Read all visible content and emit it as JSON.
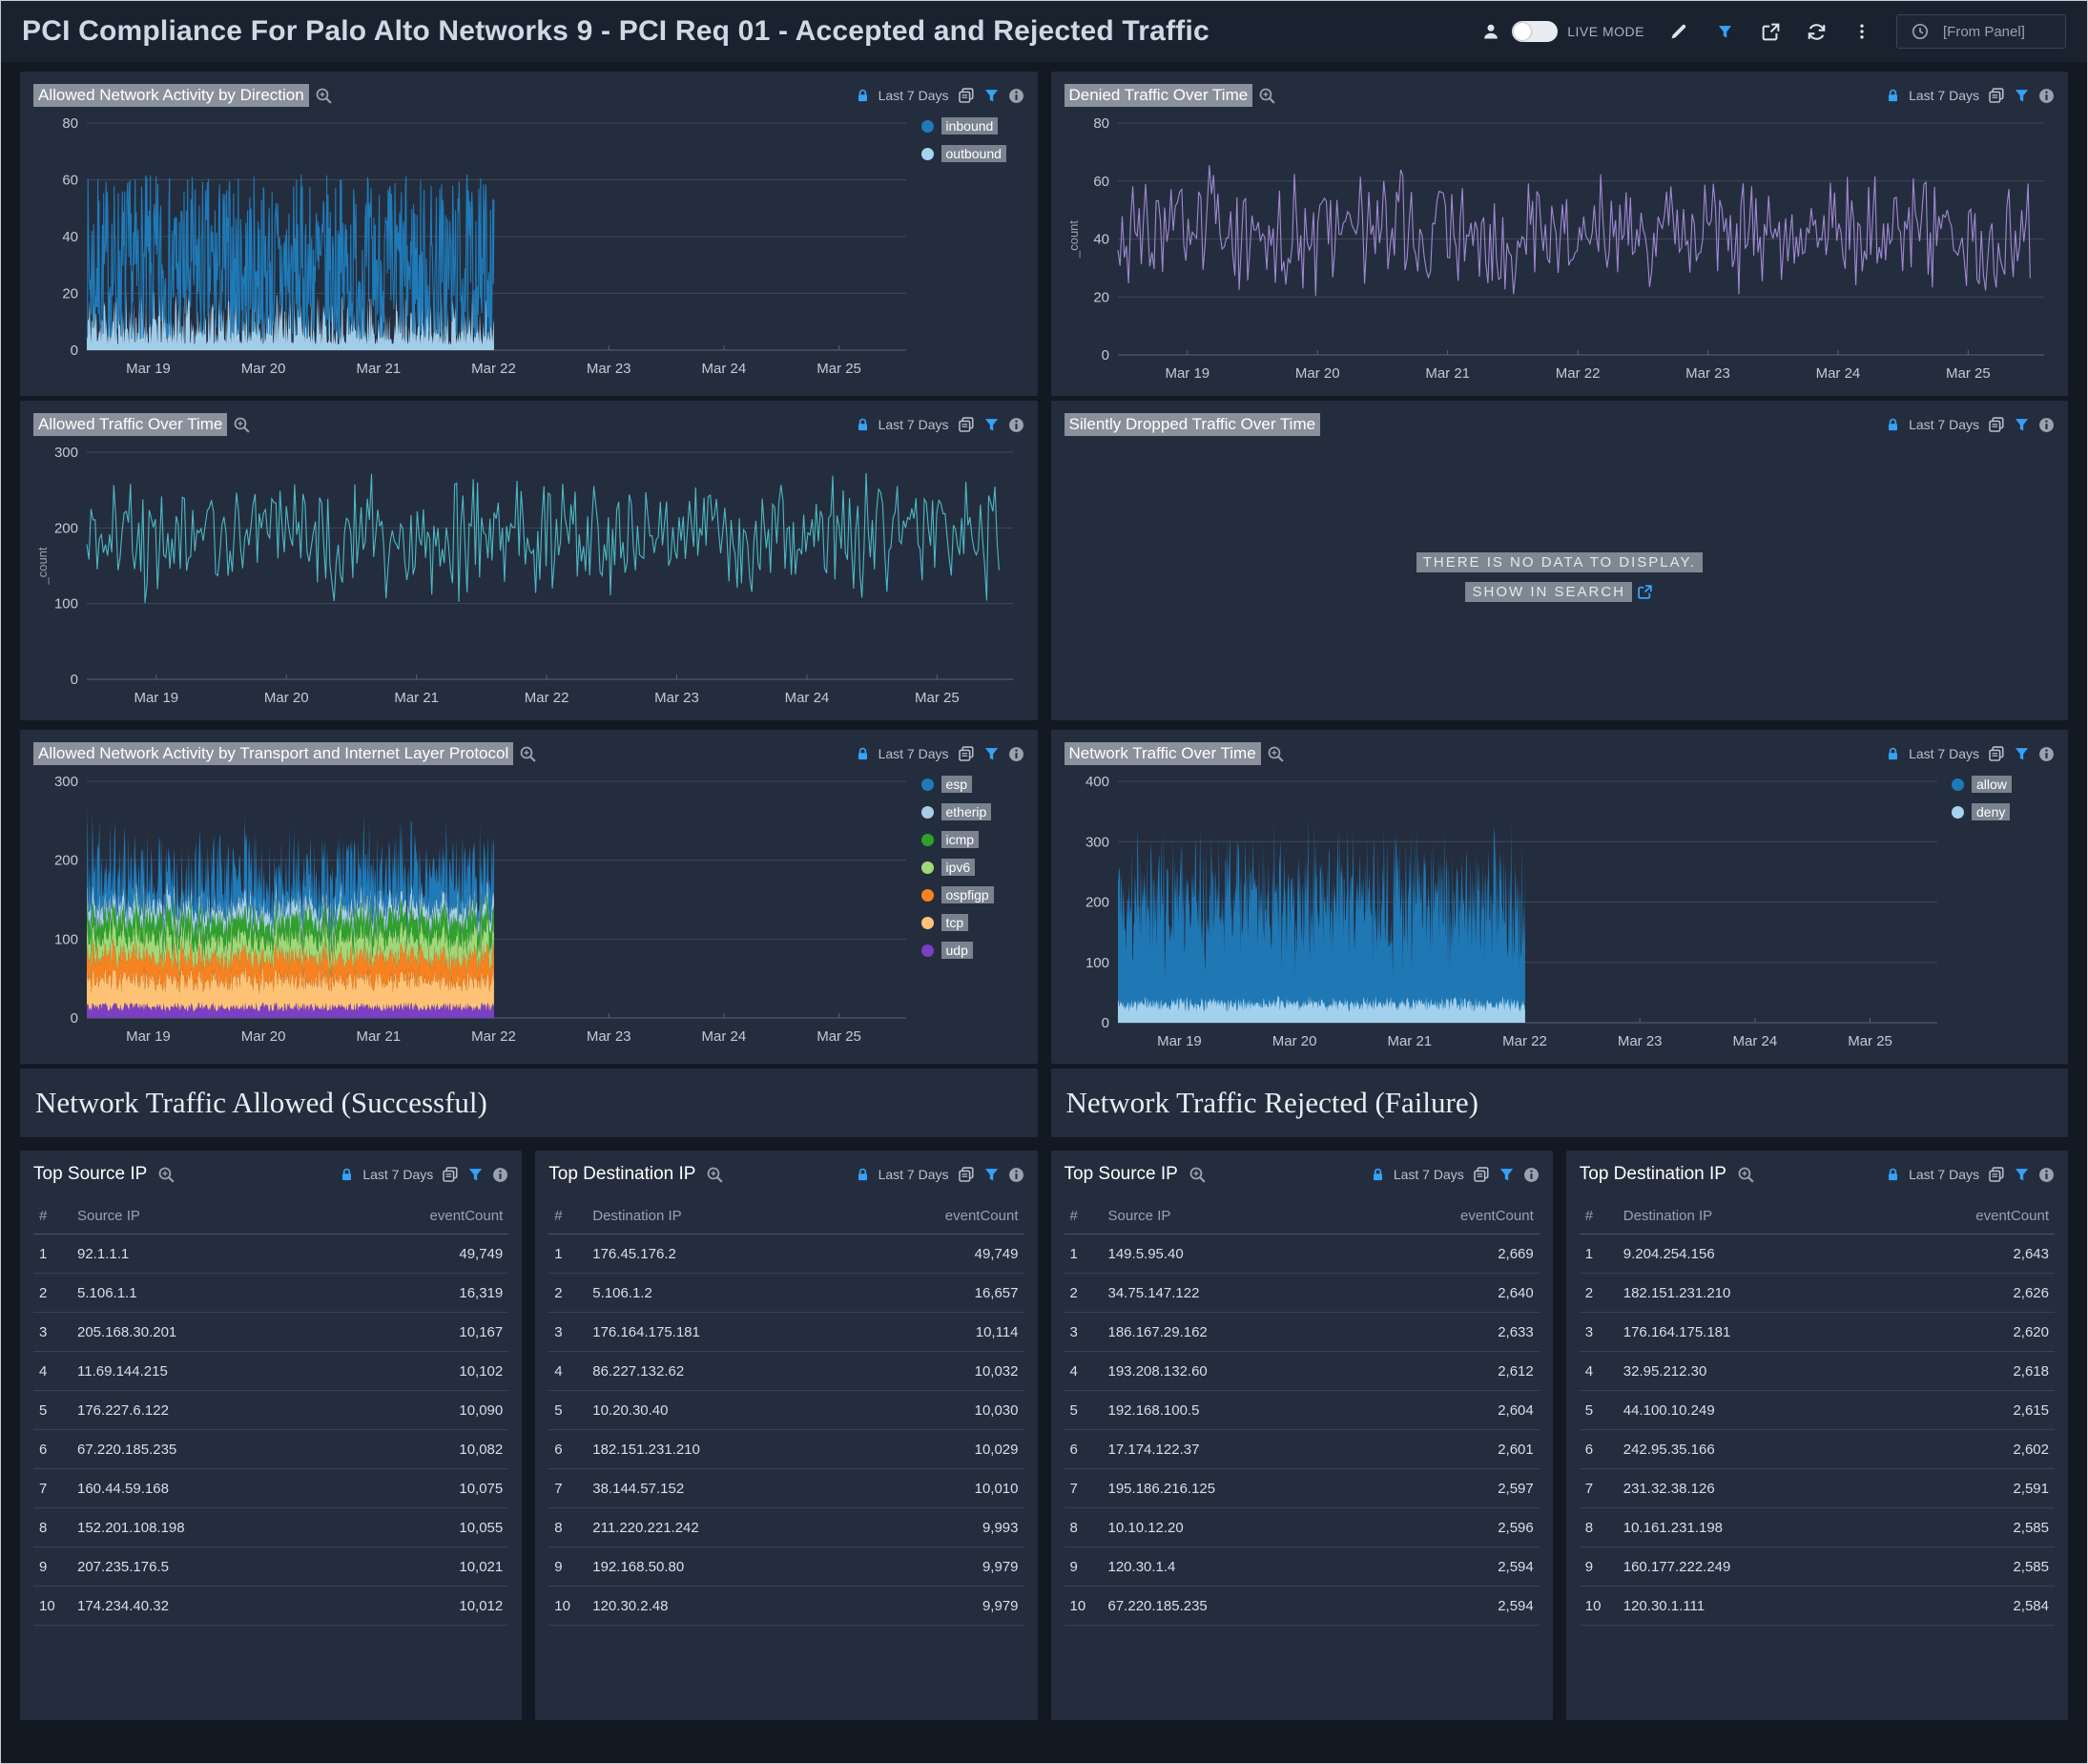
{
  "header": {
    "title": "PCI Compliance For Palo Alto Networks 9 - PCI Req 01 - Accepted and Rejected Traffic",
    "live_mode_label": "LIVE MODE",
    "time_input": "[From Panel]"
  },
  "no_data": {
    "line1": "THERE IS NO DATA TO DISPLAY.",
    "line2": "SHOW IN SEARCH"
  },
  "sections": {
    "allowed": "Network Traffic Allowed (Successful)",
    "rejected": "Network Traffic Rejected (Failure)"
  },
  "colors": {
    "dark_blue": "#1f7ab8",
    "light_blue": "#a6d3ee",
    "purple_line": "#a189d4",
    "teal": "#4cb9c5",
    "green": "#2fa12d",
    "light_green": "#a0d878",
    "orange": "#f8821f",
    "light_orange": "#fdc275",
    "violet": "#7b3fc4",
    "accent_blue": "#35a2f7",
    "panel_bg": "#242d3d",
    "page_bg": "#131923"
  },
  "chart_data": [
    {
      "id": "allowed-by-direction",
      "type": "line",
      "title": "Allowed Network Activity by Direction",
      "time_range": "Last 7 Days",
      "ylabel": "",
      "ylim": [
        0,
        80
      ],
      "yticks": [
        0,
        20,
        40,
        60,
        80
      ],
      "xticklabels": [
        "Mar 19",
        "Mar 20",
        "Mar 21",
        "Mar 22",
        "Mar 23",
        "Mar 24",
        "Mar 25"
      ],
      "x_first_frac": 0.075,
      "x_step_frac": 0.1405,
      "data_extent_frac": [
        0,
        0.497
      ],
      "grid": true,
      "legend_position": "right",
      "legend": [
        {
          "label": "inbound",
          "color": "#1f7ab8"
        },
        {
          "label": "outbound",
          "color": "#a6d3ee"
        }
      ],
      "series": [
        {
          "name": "outbound",
          "color": "#a6d3ee",
          "kind": "area",
          "band": [
            2,
            22
          ],
          "mode": "pow",
          "pow": 1.6,
          "n": 600,
          "seed": 11,
          "approx_mean": 9
        },
        {
          "name": "inbound",
          "color": "#1f7ab8",
          "kind": "line",
          "band": [
            4,
            62
          ],
          "mode": "pow",
          "pow": 1.35,
          "n": 700,
          "seed": 7,
          "approx_mean": 27
        }
      ]
    },
    {
      "id": "denied-over-time",
      "type": "line",
      "title": "Denied Traffic Over Time",
      "time_range": "Last 7 Days",
      "ylabel": "_count",
      "ylim": [
        0,
        80
      ],
      "yticks": [
        0,
        20,
        40,
        60,
        80
      ],
      "xticklabels": [
        "Mar 19",
        "Mar 20",
        "Mar 21",
        "Mar 22",
        "Mar 23",
        "Mar 24",
        "Mar 25"
      ],
      "x_first_frac": 0.075,
      "x_step_frac": 0.1405,
      "data_extent_frac": [
        0,
        0.985
      ],
      "grid": true,
      "legend_position": "none",
      "legend": [],
      "series": [
        {
          "name": "_count",
          "color": "#a189d4",
          "kind": "line",
          "band": [
            18,
            66
          ],
          "mode": "mid",
          "n": 430,
          "seed": 3,
          "approx_mean": 40
        }
      ]
    },
    {
      "id": "allowed-over-time",
      "type": "line",
      "title": "Allowed Traffic Over Time",
      "time_range": "Last 7 Days",
      "ylabel": "_count",
      "ylim": [
        0,
        300
      ],
      "yticks": [
        0,
        100,
        200,
        300
      ],
      "xticklabels": [
        "Mar 19",
        "Mar 20",
        "Mar 21",
        "Mar 22",
        "Mar 23",
        "Mar 24",
        "Mar 25"
      ],
      "x_first_frac": 0.075,
      "x_step_frac": 0.1405,
      "data_extent_frac": [
        0,
        0.985
      ],
      "grid": true,
      "legend_position": "none",
      "legend": [],
      "series": [
        {
          "name": "_count",
          "color": "#4cb9c5",
          "kind": "line",
          "band": [
            95,
            285
          ],
          "mode": "mid",
          "n": 440,
          "seed": 21,
          "approx_mean": 185
        }
      ]
    },
    {
      "id": "silently-dropped",
      "type": "line",
      "title": "Silently Dropped Traffic Over Time",
      "time_range": "Last 7 Days",
      "no_data": true,
      "legend_position": "none",
      "legend": [],
      "series": []
    },
    {
      "id": "allowed-by-protocol",
      "type": "area",
      "title": "Allowed Network Activity by Transport and Internet Layer Protocol",
      "time_range": "Last 7 Days",
      "ylabel": "",
      "ylim": [
        0,
        300
      ],
      "yticks": [
        0,
        100,
        200,
        300
      ],
      "xticklabels": [
        "Mar 19",
        "Mar 20",
        "Mar 21",
        "Mar 22",
        "Mar 23",
        "Mar 24",
        "Mar 25"
      ],
      "x_first_frac": 0.075,
      "x_step_frac": 0.1405,
      "data_extent_frac": [
        0,
        0.497
      ],
      "grid": true,
      "legend_position": "right",
      "stacked": true,
      "legend": [
        {
          "label": "esp",
          "color": "#1f7ab8"
        },
        {
          "label": "etherip",
          "color": "#a6cee3"
        },
        {
          "label": "icmp",
          "color": "#2fa12d"
        },
        {
          "label": "ipv6",
          "color": "#a0d878"
        },
        {
          "label": "ospfigp",
          "color": "#f8821f"
        },
        {
          "label": "tcp",
          "color": "#fdc275"
        },
        {
          "label": "udp",
          "color": "#7b3fc4"
        }
      ],
      "stack_order_bottom_to_top": [
        "udp",
        "tcp",
        "ospfigp",
        "ipv6",
        "icmp",
        "etherip",
        "esp"
      ],
      "series": [
        {
          "name": "udp",
          "color": "#7b3fc4",
          "kind": "stack",
          "band": [
            8,
            20
          ],
          "mode": "pow",
          "pow": 1.0,
          "n": 520,
          "seed": 31,
          "approx_mean": 14
        },
        {
          "name": "tcp",
          "color": "#fdc275",
          "kind": "stack",
          "band": [
            22,
            48
          ],
          "mode": "pow",
          "pow": 1.0,
          "n": 520,
          "seed": 32,
          "approx_mean": 35
        },
        {
          "name": "ospfigp",
          "color": "#f8821f",
          "kind": "stack",
          "band": [
            18,
            40
          ],
          "mode": "pow",
          "pow": 1.0,
          "n": 520,
          "seed": 33,
          "approx_mean": 29
        },
        {
          "name": "ipv6",
          "color": "#a0d878",
          "kind": "stack",
          "band": [
            14,
            34
          ],
          "mode": "pow",
          "pow": 1.0,
          "n": 520,
          "seed": 34,
          "approx_mean": 24
        },
        {
          "name": "icmp",
          "color": "#2fa12d",
          "kind": "stack",
          "band": [
            14,
            34
          ],
          "mode": "pow",
          "pow": 1.0,
          "n": 520,
          "seed": 35,
          "approx_mean": 24
        },
        {
          "name": "etherip",
          "color": "#a6cee3",
          "kind": "stack",
          "band": [
            8,
            24
          ],
          "mode": "pow",
          "pow": 1.0,
          "n": 520,
          "seed": 36,
          "approx_mean": 16
        },
        {
          "name": "esp",
          "color": "#1f7ab8",
          "kind": "stack",
          "band": [
            8,
            95
          ],
          "mode": "pow",
          "pow": 1.7,
          "n": 520,
          "seed": 37,
          "approx_mean": 35
        }
      ]
    },
    {
      "id": "network-traffic-over-time",
      "type": "area",
      "title": "Network Traffic Over Time",
      "time_range": "Last 7 Days",
      "ylabel": "",
      "ylim": [
        0,
        400
      ],
      "yticks": [
        0,
        100,
        200,
        300,
        400
      ],
      "xticklabels": [
        "Mar 19",
        "Mar 20",
        "Mar 21",
        "Mar 22",
        "Mar 23",
        "Mar 24",
        "Mar 25"
      ],
      "x_first_frac": 0.075,
      "x_step_frac": 0.1405,
      "data_extent_frac": [
        0,
        0.497
      ],
      "grid": true,
      "legend_position": "right",
      "legend": [
        {
          "label": "allow",
          "color": "#1f7ab8"
        },
        {
          "label": "deny",
          "color": "#a6d3ee"
        }
      ],
      "series": [
        {
          "name": "allow",
          "color": "#1f7ab8",
          "kind": "area",
          "band": [
            70,
            345
          ],
          "mode": "mid",
          "n": 650,
          "seed": 41,
          "approx_mean": 205
        },
        {
          "name": "deny",
          "color": "#a6d3ee",
          "kind": "area",
          "band": [
            16,
            46
          ],
          "mode": "mid",
          "n": 650,
          "seed": 42,
          "approx_mean": 31
        }
      ]
    }
  ],
  "tables": [
    {
      "title": "Top Source IP",
      "time_range": "Last 7 Days",
      "columns": [
        "#",
        "Source IP",
        "eventCount"
      ],
      "rows": [
        [
          "1",
          "92.1.1.1",
          "49,749"
        ],
        [
          "2",
          "5.106.1.1",
          "16,319"
        ],
        [
          "3",
          "205.168.30.201",
          "10,167"
        ],
        [
          "4",
          "11.69.144.215",
          "10,102"
        ],
        [
          "5",
          "176.227.6.122",
          "10,090"
        ],
        [
          "6",
          "67.220.185.235",
          "10,082"
        ],
        [
          "7",
          "160.44.59.168",
          "10,075"
        ],
        [
          "8",
          "152.201.108.198",
          "10,055"
        ],
        [
          "9",
          "207.235.176.5",
          "10,021"
        ],
        [
          "10",
          "174.234.40.32",
          "10,012"
        ]
      ]
    },
    {
      "title": "Top Destination IP",
      "time_range": "Last 7 Days",
      "columns": [
        "#",
        "Destination IP",
        "eventCount"
      ],
      "rows": [
        [
          "1",
          "176.45.176.2",
          "49,749"
        ],
        [
          "2",
          "5.106.1.2",
          "16,657"
        ],
        [
          "3",
          "176.164.175.181",
          "10,114"
        ],
        [
          "4",
          "86.227.132.62",
          "10,032"
        ],
        [
          "5",
          "10.20.30.40",
          "10,030"
        ],
        [
          "6",
          "182.151.231.210",
          "10,029"
        ],
        [
          "7",
          "38.144.57.152",
          "10,010"
        ],
        [
          "8",
          "211.220.221.242",
          "9,993"
        ],
        [
          "9",
          "192.168.50.80",
          "9,979"
        ],
        [
          "10",
          "120.30.2.48",
          "9,979"
        ]
      ]
    },
    {
      "title": "Top Source IP",
      "time_range": "Last 7 Days",
      "columns": [
        "#",
        "Source IP",
        "eventCount"
      ],
      "rows": [
        [
          "1",
          "149.5.95.40",
          "2,669"
        ],
        [
          "2",
          "34.75.147.122",
          "2,640"
        ],
        [
          "3",
          "186.167.29.162",
          "2,633"
        ],
        [
          "4",
          "193.208.132.60",
          "2,612"
        ],
        [
          "5",
          "192.168.100.5",
          "2,604"
        ],
        [
          "6",
          "17.174.122.37",
          "2,601"
        ],
        [
          "7",
          "195.186.216.125",
          "2,597"
        ],
        [
          "8",
          "10.10.12.20",
          "2,596"
        ],
        [
          "9",
          "120.30.1.4",
          "2,594"
        ],
        [
          "10",
          "67.220.185.235",
          "2,594"
        ]
      ]
    },
    {
      "title": "Top Destination IP",
      "time_range": "Last 7 Days",
      "columns": [
        "#",
        "Destination IP",
        "eventCount"
      ],
      "rows": [
        [
          "1",
          "9.204.254.156",
          "2,643"
        ],
        [
          "2",
          "182.151.231.210",
          "2,626"
        ],
        [
          "3",
          "176.164.175.181",
          "2,620"
        ],
        [
          "4",
          "32.95.212.30",
          "2,618"
        ],
        [
          "5",
          "44.100.10.249",
          "2,615"
        ],
        [
          "6",
          "242.95.35.166",
          "2,602"
        ],
        [
          "7",
          "231.32.38.126",
          "2,591"
        ],
        [
          "8",
          "10.161.231.198",
          "2,585"
        ],
        [
          "9",
          "160.177.222.249",
          "2,585"
        ],
        [
          "10",
          "120.30.1.111",
          "2,584"
        ]
      ]
    }
  ]
}
